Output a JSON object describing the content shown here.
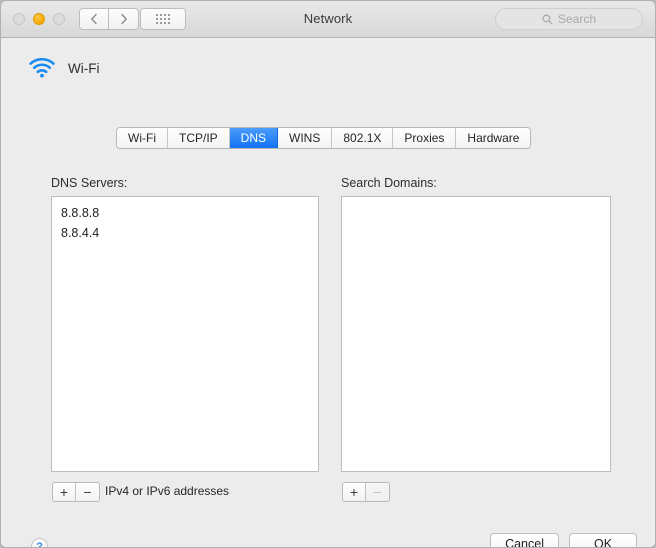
{
  "window": {
    "title": "Network",
    "traffic_lights": [
      {
        "name": "close",
        "state": "inactive"
      },
      {
        "name": "minimize",
        "state": "amber"
      },
      {
        "name": "zoom",
        "state": "inactive"
      }
    ],
    "nav": {
      "back_icon": "chevron-left-icon",
      "forward_icon": "chevron-right-icon",
      "grid_icon": "show-all-grid-icon"
    },
    "search": {
      "icon": "search-icon",
      "placeholder": "Search",
      "value": ""
    }
  },
  "service": {
    "icon": "wifi-icon",
    "name": "Wi-Fi"
  },
  "tabs": [
    {
      "label": "Wi-Fi",
      "selected": false
    },
    {
      "label": "TCP/IP",
      "selected": false
    },
    {
      "label": "DNS",
      "selected": true
    },
    {
      "label": "WINS",
      "selected": false
    },
    {
      "label": "802.1X",
      "selected": false
    },
    {
      "label": "Proxies",
      "selected": false
    },
    {
      "label": "Hardware",
      "selected": false
    }
  ],
  "dns_servers": {
    "label": "DNS Servers:",
    "items": [
      "8.8.8.8",
      "8.8.4.4"
    ],
    "add_label": "+",
    "remove_label": "−",
    "add_enabled": true,
    "remove_enabled": true,
    "hint": "IPv4 or IPv6 addresses"
  },
  "search_domains": {
    "label": "Search Domains:",
    "items": [],
    "add_label": "+",
    "remove_label": "−",
    "add_enabled": true,
    "remove_enabled": false
  },
  "footer": {
    "help_label": "?",
    "cancel_label": "Cancel",
    "ok_label": "OK"
  },
  "colors": {
    "accent": "#1273f2",
    "amber": "#f6a800",
    "wifi_blue": "#1a8cf0",
    "help_blue": "#3b8bf0"
  }
}
